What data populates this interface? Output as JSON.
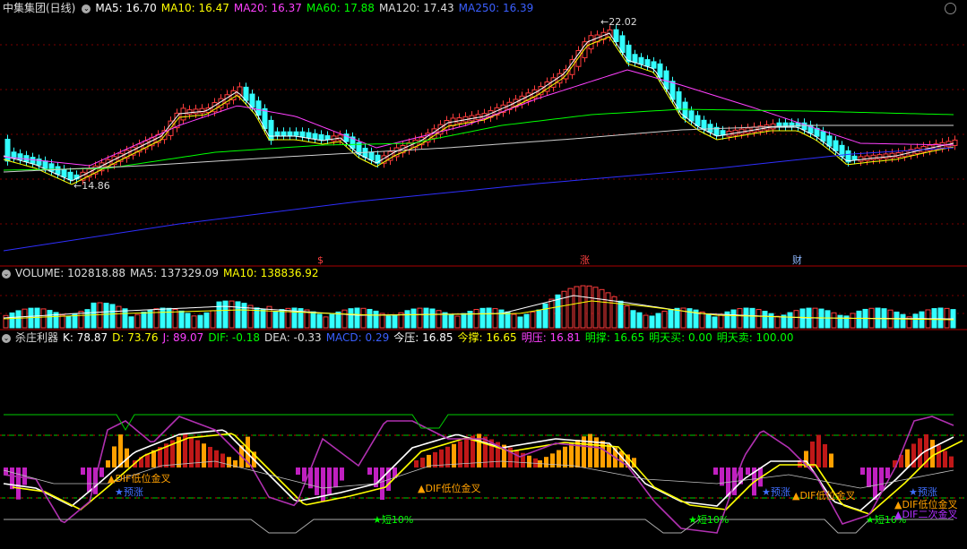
{
  "colors": {
    "up": "#ff3c3c",
    "down": "#3ff",
    "ma5": "#ffffff",
    "ma10": "#ffff00",
    "ma20": "#ff40ff",
    "ma60": "#00ff00",
    "ma120": "#cfcfcf",
    "ma250": "#2f2fff",
    "grid": "#7a0000",
    "k": "#ffffff",
    "d": "#ffff00",
    "j": "#b030b0",
    "cyan": "#00ffff",
    "orange": "#ffa000",
    "green": "#00ff00",
    "magenta": "#ff00ff",
    "blue": "#3f6fff"
  },
  "header": {
    "title": "中集集团(日线)",
    "ma5": "MA5: 16.70",
    "ma10": "MA10: 16.47",
    "ma20": "MA20: 16.37",
    "ma60": "MA60: 17.88",
    "ma120": "MA120: 17.43",
    "ma250": "MA250: 16.39"
  },
  "price": {
    "high_label": "22.02",
    "low_label": "14.86",
    "markers": [
      {
        "text": "$",
        "color": "#ff4040"
      },
      {
        "text": "涨",
        "color": "#ff4040"
      },
      {
        "text": "财",
        "color": "#8fb8ff"
      }
    ]
  },
  "volume": {
    "label": "VOLUME: 102818.88",
    "ma5": "MA5: 137329.09",
    "ma10": "MA10: 138836.92"
  },
  "indicator": {
    "name": "杀庄利器",
    "k": "K: 78.87",
    "d": "D: 73.76",
    "j": "J: 89.07",
    "dif": "DIF: -0.18",
    "dea": "DEA: -0.33",
    "macd": "MACD: 0.29",
    "jinya": "今压: 16.85",
    "jincheng": "今撑: 16.65",
    "mingya": "明压: 16.81",
    "mingcheng": "明撑: 16.65",
    "mtm": "明天买: 0.00",
    "mts": "明天卖: 100.00",
    "signals": {
      "yuzhang": "★预涨",
      "dif_low_gold": "▲DIF低位金叉",
      "short10": "★短10%",
      "dif_second_gold": "▲DIF二次金叉"
    }
  }
}
